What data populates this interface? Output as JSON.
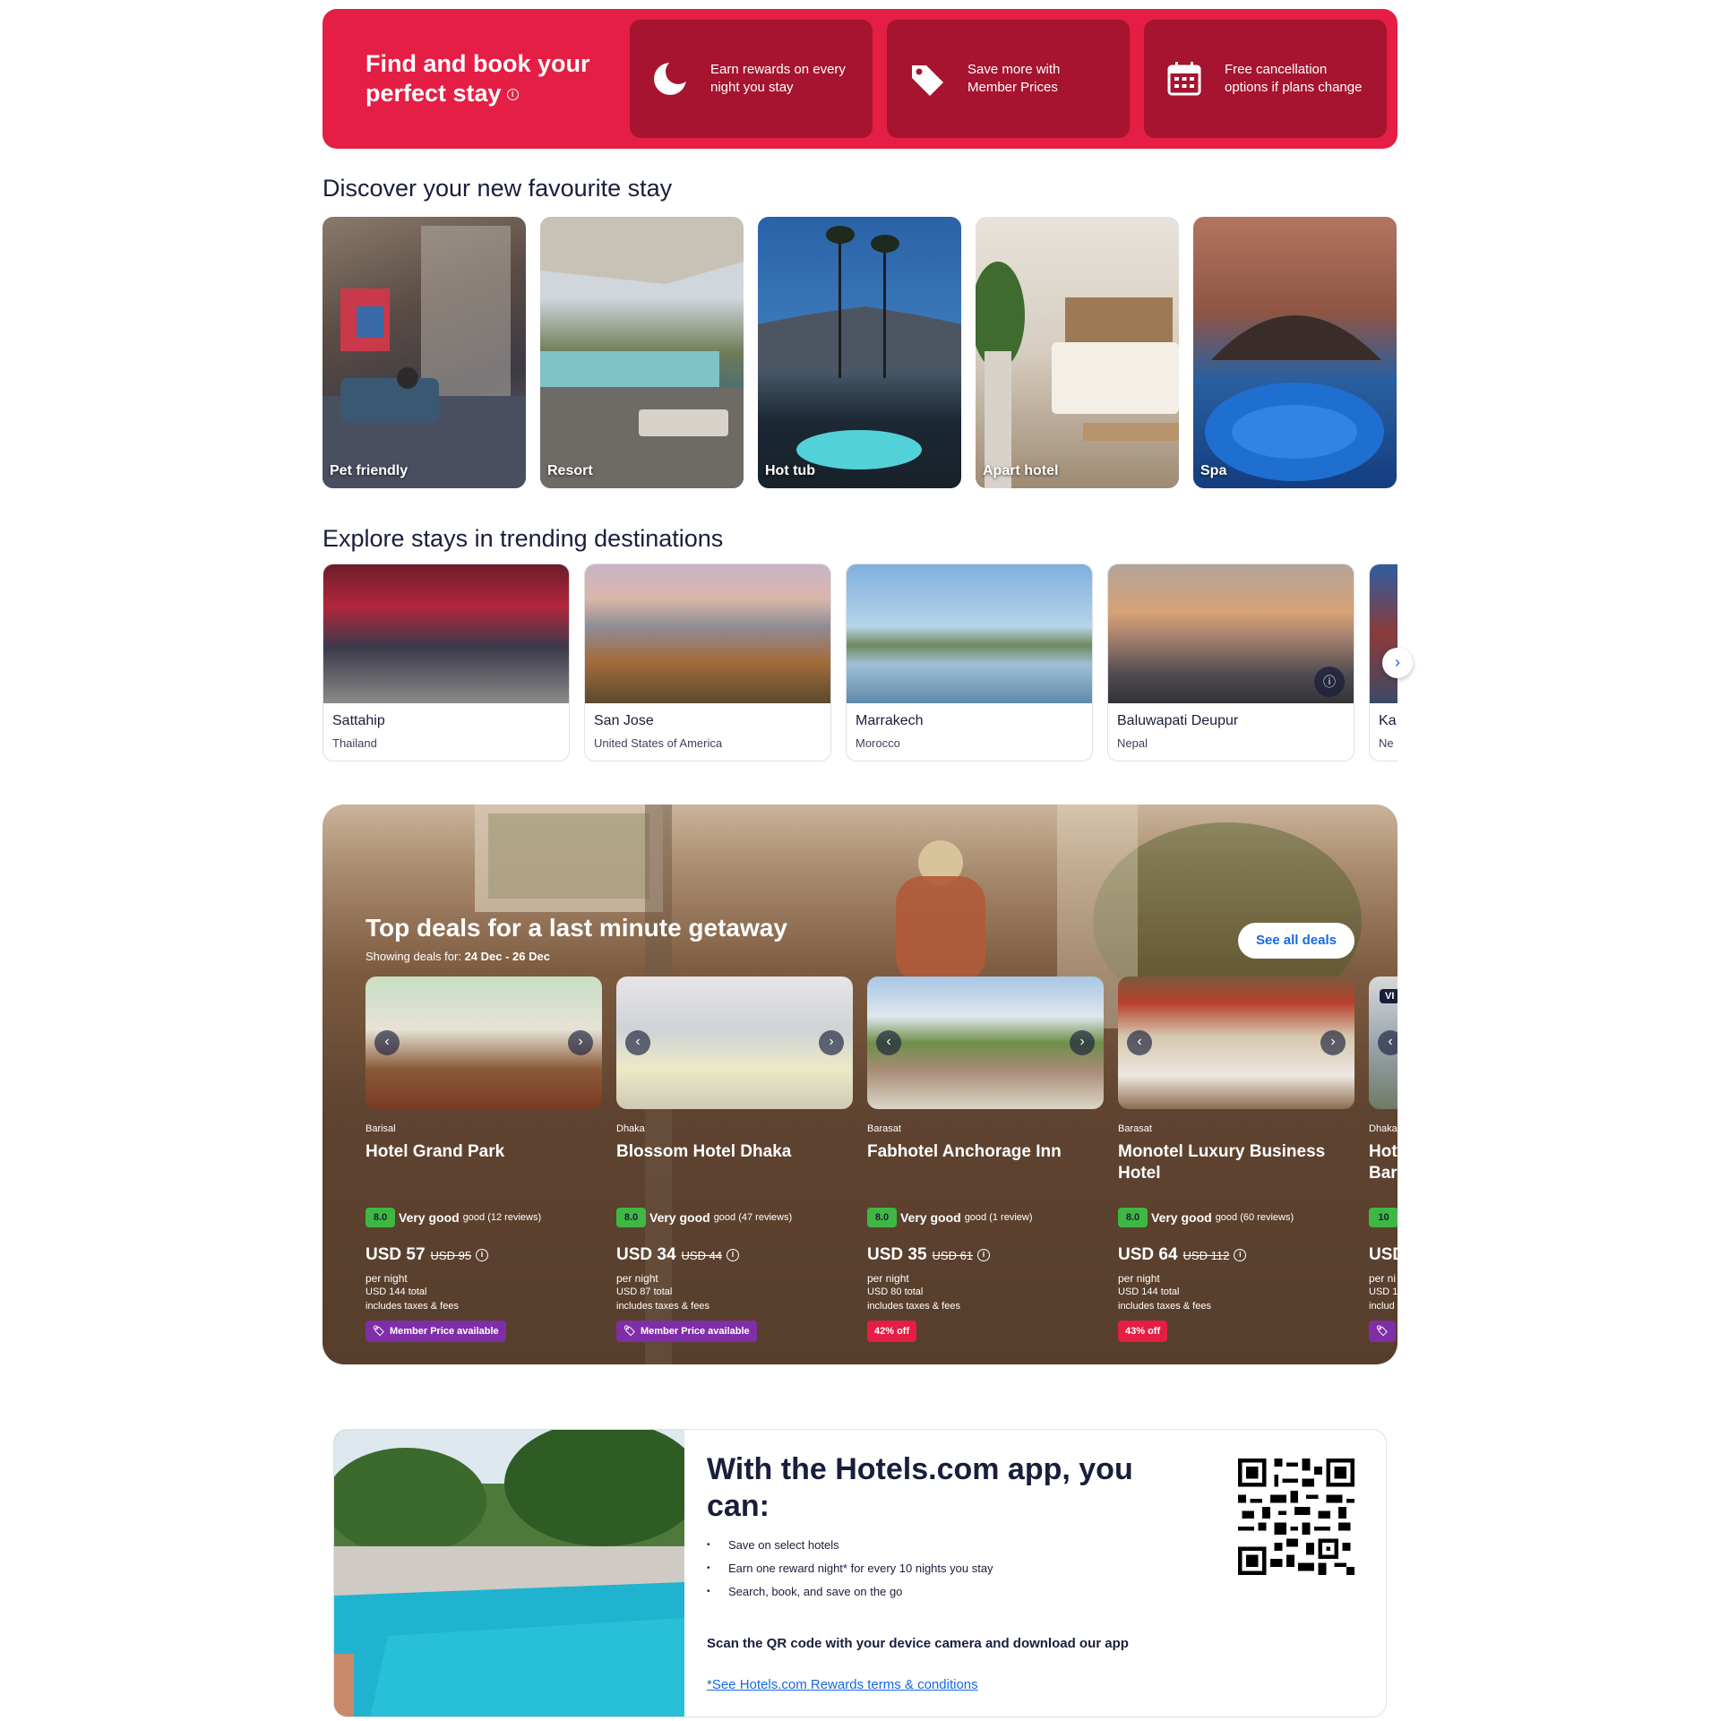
{
  "hero": {
    "title": "Find and book your perfect stay",
    "cards": [
      {
        "icon": "moon-icon",
        "text": "Earn rewards on every night you stay"
      },
      {
        "icon": "tag-icon",
        "text": "Save more with Member Prices"
      },
      {
        "icon": "calendar-icon",
        "text": "Free cancellation options if plans change"
      }
    ]
  },
  "discover": {
    "title": "Discover your new favourite stay",
    "items": [
      {
        "label": "Pet friendly"
      },
      {
        "label": "Resort"
      },
      {
        "label": "Hot tub"
      },
      {
        "label": "Apart hotel"
      },
      {
        "label": "Spa"
      }
    ]
  },
  "trending": {
    "title": "Explore stays in trending destinations",
    "items": [
      {
        "name": "Sattahip",
        "country": "Thailand"
      },
      {
        "name": "San Jose",
        "country": "United States of America"
      },
      {
        "name": "Marrakech",
        "country": "Morocco"
      },
      {
        "name": "Baluwapati Deupur",
        "country": "Nepal"
      },
      {
        "name": "Ka",
        "country": "Ne"
      }
    ]
  },
  "deals": {
    "title": "Top deals for a last minute getaway",
    "subtitle_prefix": "Showing deals for:",
    "subtitle_dates": "24 Dec - 26 Dec",
    "see_all": "See all deals",
    "items": [
      {
        "city": "Barisal",
        "name": "Hotel Grand Park",
        "rating": "8.0",
        "rating_word": "Very good",
        "rating_count": "good (12 reviews)",
        "price": "USD 57",
        "old_price": "USD 95",
        "per_night": "per night",
        "total": "USD 144 total",
        "taxes": "includes taxes & fees",
        "badge": "Member Price available",
        "badge_type": "member"
      },
      {
        "city": "Dhaka",
        "name": "Blossom Hotel Dhaka",
        "rating": "8.0",
        "rating_word": "Very good",
        "rating_count": "good (47 reviews)",
        "price": "USD 34",
        "old_price": "USD 44",
        "per_night": "per night",
        "total": "USD 87 total",
        "taxes": "includes taxes & fees",
        "badge": "Member Price available",
        "badge_type": "member"
      },
      {
        "city": "Barasat",
        "name": "Fabhotel Anchorage Inn",
        "rating": "8.0",
        "rating_word": "Very good",
        "rating_count": "good (1 review)",
        "price": "USD 35",
        "old_price": "USD 61",
        "per_night": "per night",
        "total": "USD 80 total",
        "taxes": "includes taxes & fees",
        "badge": "42% off",
        "badge_type": "off"
      },
      {
        "city": "Barasat",
        "name": "Monotel Luxury Business Hotel",
        "rating": "8.0",
        "rating_word": "Very good",
        "rating_count": "good (60 reviews)",
        "price": "USD 64",
        "old_price": "USD 112",
        "per_night": "per night",
        "total": "USD 144 total",
        "taxes": "includes taxes & fees",
        "badge": "43% off",
        "badge_type": "off"
      },
      {
        "city": "Dhaka",
        "name": "Hot Bar",
        "rating": "10",
        "rating_word": "",
        "rating_count": "",
        "price": "USD",
        "old_price": "",
        "per_night": "per ni",
        "total": "USD 1",
        "taxes": "includ",
        "badge": "",
        "badge_type": "member",
        "vip": "VI"
      }
    ]
  },
  "app": {
    "title": "With the Hotels.com app, you can:",
    "benefits": [
      "Save on select hotels",
      "Earn one reward night* for every 10 nights you stay",
      "Search, book, and save on the go"
    ],
    "scan_text": "Scan the QR code with your device camera and download our app",
    "terms_link": "*See Hotels.com Rewards terms & conditions"
  },
  "colors": {
    "brand_red": "#e41e44",
    "brand_dark_red": "#a6142f",
    "text_navy": "#191e3b",
    "link_blue": "#1668e3",
    "rating_green": "#3fb843",
    "member_purple": "#7f2ea8"
  }
}
